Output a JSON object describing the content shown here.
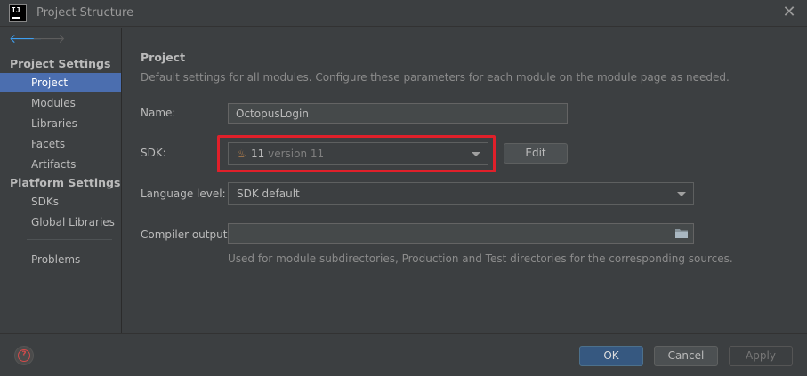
{
  "window": {
    "title": "Project Structure",
    "logo_text": "IJ"
  },
  "sidebar": {
    "project_settings_header": "Project Settings",
    "project_settings_items": [
      {
        "label": "Project",
        "selected": true
      },
      {
        "label": "Modules",
        "selected": false
      },
      {
        "label": "Libraries",
        "selected": false
      },
      {
        "label": "Facets",
        "selected": false
      },
      {
        "label": "Artifacts",
        "selected": false
      }
    ],
    "platform_settings_header": "Platform Settings",
    "platform_settings_items": [
      {
        "label": "SDKs"
      },
      {
        "label": "Global Libraries"
      }
    ],
    "problems_label": "Problems"
  },
  "main": {
    "section_title": "Project",
    "section_description": "Default settings for all modules. Configure these parameters for each module on the module page as needed.",
    "name_label": "Name:",
    "name_value": "OctopusLogin",
    "sdk_label": "SDK:",
    "sdk_name": "11",
    "sdk_version": "version 11",
    "edit_label": "Edit",
    "language_level_label": "Language level:",
    "language_level_value": "SDK default",
    "compiler_output_label": "Compiler output:",
    "compiler_output_value": "",
    "compiler_output_hint": "Used for module subdirectories, Production and Test directories for the corresponding sources."
  },
  "footer": {
    "help_symbol": "?",
    "ok_label": "OK",
    "cancel_label": "Cancel",
    "apply_label": "Apply"
  },
  "colors": {
    "background": "#3c3f41",
    "selection": "#4b6eaf",
    "highlight_border": "#e0202a",
    "ok_button": "#365880",
    "back_arrow": "#3f9ff0"
  }
}
